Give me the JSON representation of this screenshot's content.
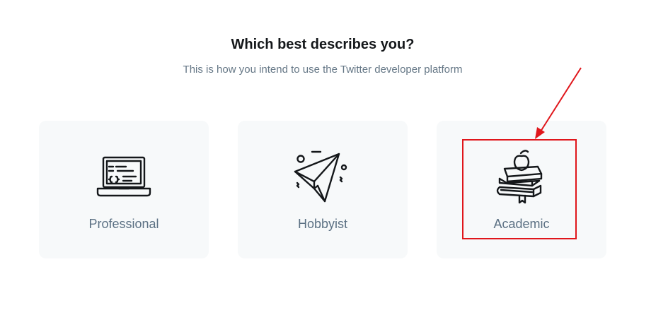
{
  "header": {
    "title": "Which best describes you?",
    "subtitle": "This is how you intend to use the Twitter developer platform"
  },
  "options": [
    {
      "label": "Professional",
      "icon": "laptop-code-icon"
    },
    {
      "label": "Hobbyist",
      "icon": "paper-plane-icon"
    },
    {
      "label": "Academic",
      "icon": "books-apple-icon"
    }
  ],
  "annotation": {
    "highlight_color": "#e0161b",
    "highlighted_option": "Academic"
  },
  "colors": {
    "card_background": "#f7f9fa",
    "title_text": "#14171a",
    "secondary_text": "#657786",
    "icon_stroke": "#14171a"
  }
}
